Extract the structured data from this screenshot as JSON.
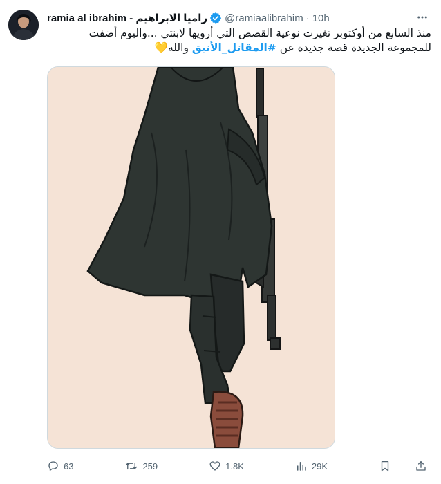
{
  "author": {
    "name": "ramia al ibrahim - راميا الابراهيم",
    "handle": "@ramiaalibrahim",
    "separator": "·",
    "time": "10h"
  },
  "tweet": {
    "line1": "منذ السابع من أوكتوبر تغيرت نوعية القصص التي أرويها لابنتي ...واليوم أضفت",
    "line2_before": "للمجموعة الجديدة قصة جديدة عن",
    "hashtag": "#المقاتل_الأنيق",
    "line2_after": "والله",
    "emoji": "💛"
  },
  "actions": {
    "replies": "63",
    "reposts": "259",
    "likes": "1.8K",
    "views": "29K"
  },
  "icons": {
    "avatar": "profile-photo",
    "verified": "verified-badge-icon",
    "more": "more-dots-icon",
    "reply": "reply-icon",
    "repost": "repost-icon",
    "like": "heart-icon",
    "views": "views-icon",
    "bookmark": "bookmark-icon",
    "share": "share-icon"
  },
  "colors": {
    "accent": "#1d9bf0",
    "muted": "#536471",
    "illustration_background": "#f5e3d6"
  }
}
